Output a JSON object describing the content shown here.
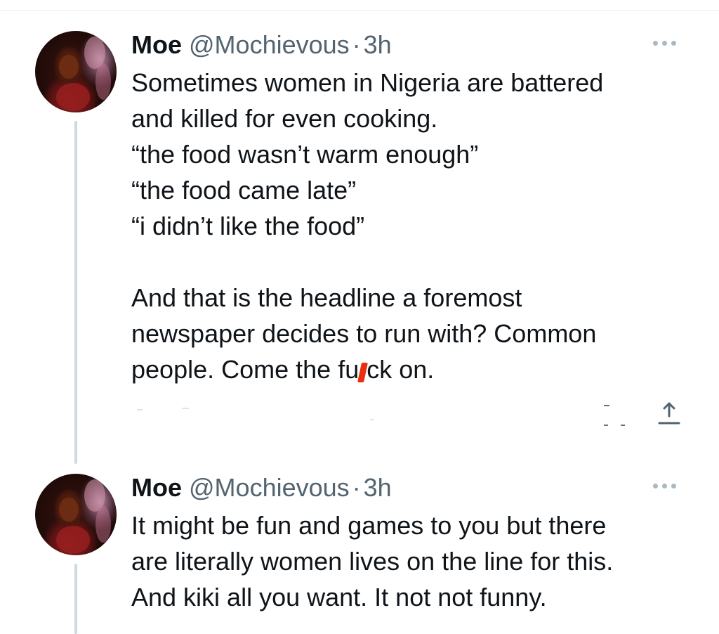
{
  "tweets": [
    {
      "name": "Moe",
      "handle": "@Mochievous",
      "separator": "·",
      "time": "3h",
      "lines": [
        "Sometimes women in Nigeria are battered",
        "and killed for even cooking.",
        "“the food wasn’t warm enough”",
        "“the food came late”",
        "“i didn’t like the food”",
        "",
        "And that is the headline a foremost",
        "newspaper decides to run with? Common"
      ],
      "last_line_prefix": "people. Come the fu",
      "last_line_suffix": "ck on."
    },
    {
      "name": "Moe",
      "handle": "@Mochievous",
      "separator": "·",
      "time": "3h",
      "lines": [
        "It might be fun and games to you but there",
        "are literally women lives on the line for this.",
        "And kiki all you want. It not not funny."
      ]
    }
  ],
  "icons": {
    "more": "more-horizontal-icon",
    "share": "share-icon",
    "censor": "censor-mark"
  },
  "colors": {
    "text": "#0f1419",
    "secondary": "#536471",
    "thread_line": "#cfd9de",
    "censor": "#e8300f"
  }
}
